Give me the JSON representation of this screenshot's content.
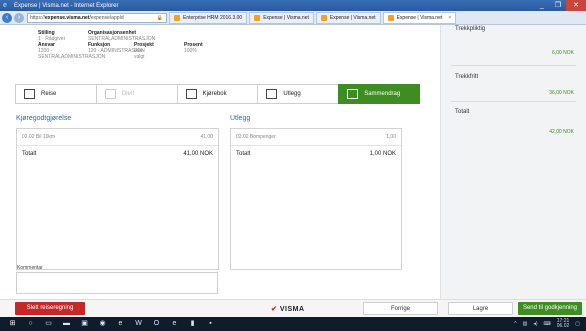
{
  "window": {
    "title": "Expense | Visma.net - Internet Explorer",
    "controls": [
      "_",
      "❐",
      "✕"
    ]
  },
  "browser": {
    "address_prefix": "https://",
    "address_host": "expense.visma.net",
    "address_path": "/expense/appId",
    "tabs": [
      {
        "label": "Enterprise HRM 2016.3.00",
        "active": false
      },
      {
        "label": "Expense | Visma.net",
        "active": false
      },
      {
        "label": "Expense | Visma.net",
        "active": false
      },
      {
        "label": "Expense | Visma.net",
        "active": true
      }
    ],
    "tab_close": "×"
  },
  "info": {
    "stilling_label": "Stilling",
    "stilling_value": "1 - Rådgiver",
    "org_label": "Organisasjonsenhet",
    "org_value": "SENTRALADMINISTRASJON",
    "ansvar_label": "Ansvar",
    "ansvar_value": "1200 -",
    "ansvar_value2": "SENTRALADMINISTRASJON",
    "funksjon_label": "Funksjon",
    "funksjon_value": "120 - ADMINISTRASJON",
    "prosjekt_label": "Prosjekt",
    "prosjekt_value": "Ikke valgt",
    "prosent_label": "Prosent",
    "prosent_value": "100%"
  },
  "steps": [
    {
      "label": "Reise",
      "state": "normal"
    },
    {
      "label": "Diett",
      "state": "disabled"
    },
    {
      "label": "Kjørebok",
      "state": "normal"
    },
    {
      "label": "Utlegg",
      "state": "normal"
    },
    {
      "label": "Sammendrag",
      "state": "active"
    }
  ],
  "kjoregodtgjorelse": {
    "title": "Kjøregodtgjørelse",
    "item_label": "02.02 Bil 10km",
    "item_value": "41,00",
    "total_label": "Totalt",
    "total_value": "41,00 NOK"
  },
  "utlegg": {
    "title": "Utlegg",
    "item_label": "02.02 Bompenger",
    "item_value": "1,00",
    "total_label": "Totalt",
    "total_value": "1,00 NOK"
  },
  "comment": {
    "label": "Kommentar"
  },
  "sidebar": {
    "trekkpliktig_label": "Trekkpliktig",
    "trekkpliktig_value": "6,00 NOK",
    "trekkfritt_label": "Trekkfritt",
    "trekkfritt_value": "36,00 NOK",
    "totalt_label": "Totalt",
    "totalt_value": "42,00 NOK"
  },
  "actions": {
    "delete": "Slett reiseregning",
    "logo_mark": "✔",
    "logo_text": "VISMA",
    "previous": "Forrige",
    "save": "Lagre",
    "submit": "Send til godkjenning"
  },
  "taskbar": {
    "time": "17:21",
    "date": "06.02"
  },
  "colors": {
    "accent_green": "#3e8d22",
    "danger_red": "#c62828",
    "link_blue": "#2b6cb0"
  }
}
